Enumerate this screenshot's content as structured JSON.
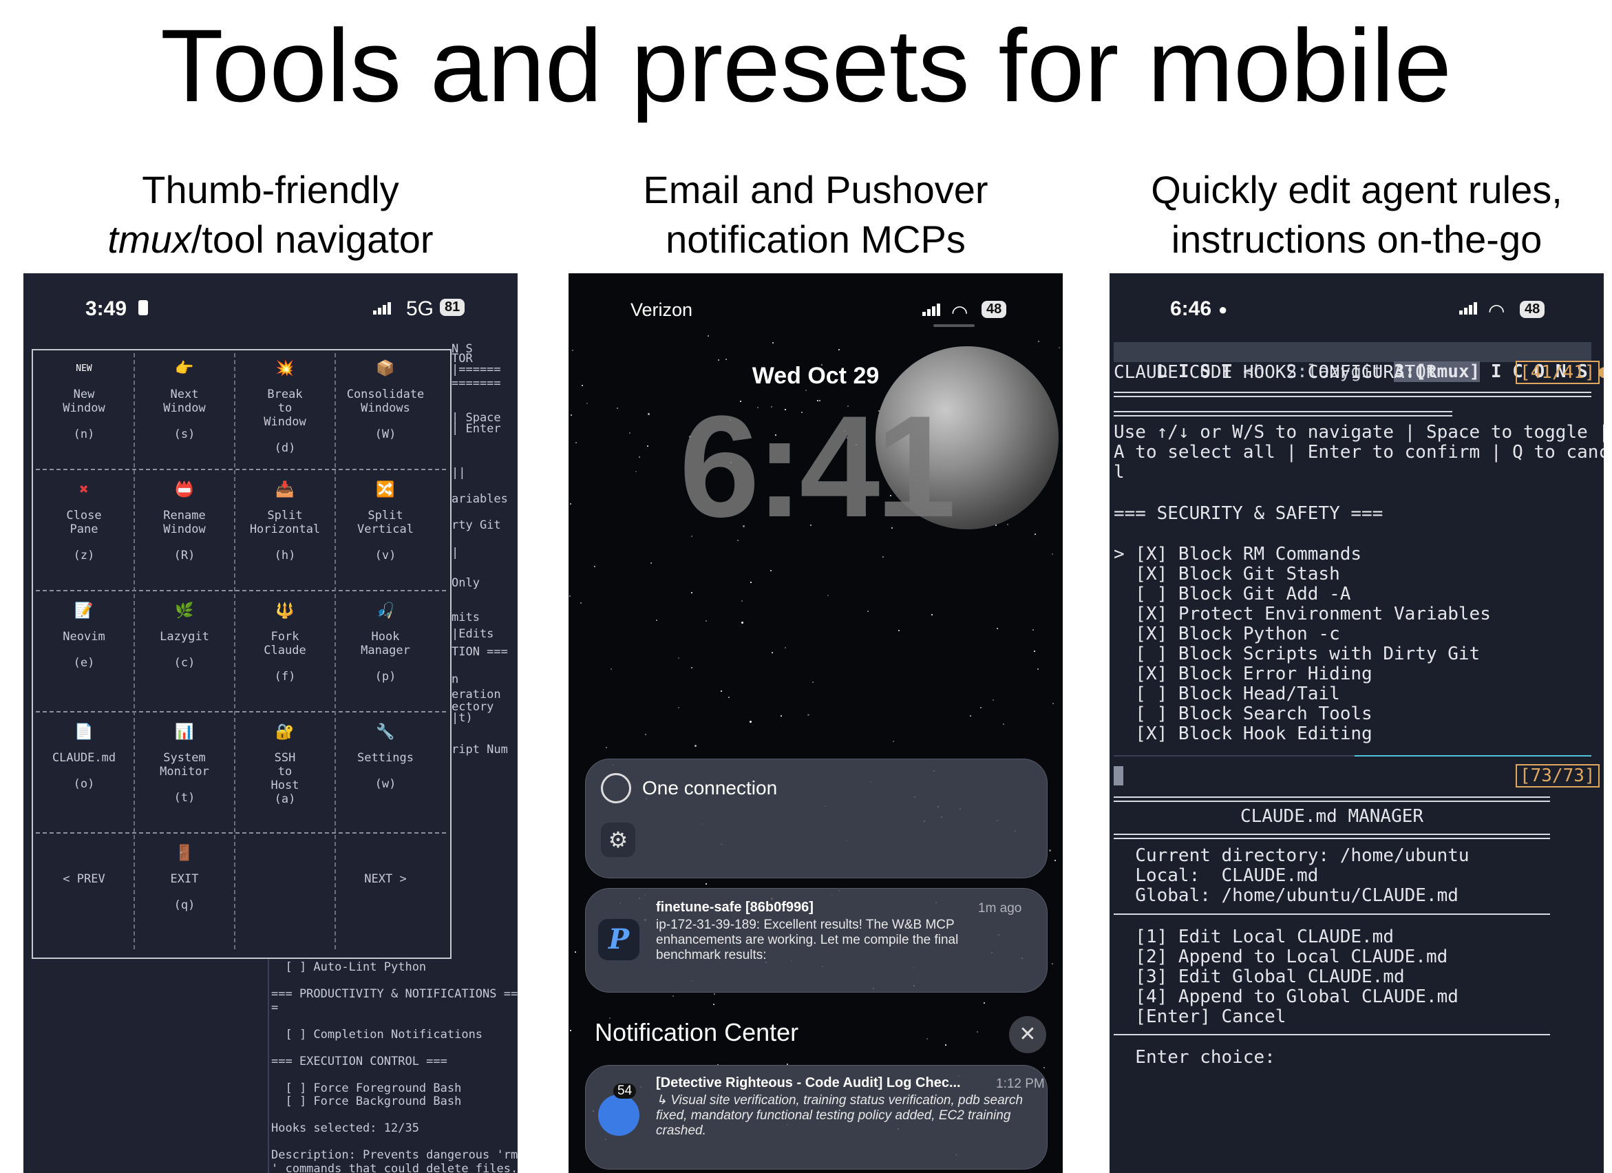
{
  "title": "Tools and presets for mobile",
  "captions": {
    "left_italic": "tmux",
    "left_line1": "Thumb-friendly",
    "left_line2_rest": "/tool navigator",
    "middle_line1": "Email and Pushover",
    "middle_line2": "notification MCPs",
    "right_line1": "Quickly edit agent rules,",
    "right_line2": "instructions on-the-go"
  },
  "phone1": {
    "time": "3:49",
    "network": "5G",
    "battery": "81",
    "cells": [
      {
        "icon": "NEW",
        "label": "New\nWindow",
        "key": "(n)"
      },
      {
        "icon": "👉",
        "label": "Next\nWindow",
        "key": "(s)"
      },
      {
        "icon": "💥",
        "label": "Break\nto\nWindow",
        "key": "(d)"
      },
      {
        "icon": "📦",
        "label": "Consolidate\nWindows",
        "key": "(W)"
      },
      {
        "icon": "✖",
        "label": "Close\nPane",
        "key": "(z)"
      },
      {
        "icon": "📛",
        "label": "Rename\nWindow",
        "key": "(R)"
      },
      {
        "icon": "📥",
        "label": "Split\nHorizontal",
        "key": "(h)"
      },
      {
        "icon": "🔀",
        "label": "Split\nVertical",
        "key": "(v)"
      },
      {
        "icon": "📝",
        "label": "Neovim",
        "key": "(e)"
      },
      {
        "icon": "🌿",
        "label": "Lazygit",
        "key": "(c)"
      },
      {
        "icon": "🔱",
        "label": "Fork\nClaude",
        "key": "(f)"
      },
      {
        "icon": "🎣",
        "label": "Hook\nManager",
        "key": "(p)"
      },
      {
        "icon": "📄",
        "label": "CLAUDE.md",
        "key": "(o)"
      },
      {
        "icon": "📊",
        "label": "System\nMonitor",
        "key": "(t)"
      },
      {
        "icon": "🔐",
        "label": "SSH\nto\nHost\n(a)",
        "key": ""
      },
      {
        "icon": "🔧",
        "label": "Settings",
        "key": "(w)"
      },
      {
        "icon": "",
        "label": "< PREV",
        "key": ""
      },
      {
        "icon": "🚪",
        "label": "EXIT",
        "key": "(q)"
      },
      {
        "icon": "",
        "label": "",
        "key": ""
      },
      {
        "icon": "",
        "label": "NEXT >",
        "key": ""
      }
    ],
    "side_text": [
      "N S",
      "TOR",
      "|======",
      "=======",
      "| Space",
      "| Enter",
      "||",
      "ariables",
      "rty Git",
      "|",
      "Only",
      "mits",
      "|Edits",
      "TION ===",
      "n",
      "eration",
      "ectory",
      "|t)",
      "ript Num"
    ],
    "bottom_lines": [
      "  [ ] Auto-Lint Python",
      "",
      "=== PRODUCTIVITY & NOTIFICATIONS ==",
      "=",
      "",
      "  [ ] Completion Notifications",
      "",
      "=== EXECUTION CONTROL ===",
      "",
      "  [ ] Force Foreground Bash",
      "  [ ] Force Background Bash",
      "",
      "Hooks selected: 12/35",
      "",
      "Description: Prevents dangerous 'rm",
      "' commands that could delete files."
    ]
  },
  "phone2": {
    "carrier": "Verizon",
    "battery": "48",
    "date": "Wed Oct 29",
    "time": "6:41",
    "connection_label": "One connection",
    "notification": {
      "title": "finetune-safe [86b0f996]",
      "time": "1m ago",
      "body": "ip-172-31-39-189: Excellent results! The W&B MCP enhancements are working. Let me compile the final benchmark results:"
    },
    "notification_center_label": "Notification Center",
    "email": {
      "badge": "54",
      "title": "[Detective Righteous - Code Audit] Log Chec...",
      "time": "1:12 PM",
      "body": "↳ Visual site verification, training status verification, pdb search fixed, mandatory functional testing policy added, EC2 training crashed."
    }
  },
  "phone3": {
    "time": "6:46",
    "battery": "48",
    "tabbar": {
      "list": "L I S T",
      "h": "<h",
      "lazygit": "2:lazygit",
      "tmux": "3:[tmux]",
      "icons": "I C O N S"
    },
    "header": "CLAUDE CODE HOOKS CONFIGURATOR",
    "counter_top": "[41/41]",
    "instructions": "Use ↑/↓ or W/S to navigate | Space to toggle |\nA to select all | Enter to confirm | Q to cance\nl",
    "section": "=== SECURITY & SAFETY ===",
    "items": [
      "> [X] Block RM Commands",
      "  [X] Block Git Stash",
      "  [ ] Block Git Add -A",
      "  [X] Protect Environment Variables",
      "  [X] Block Python -c",
      "  [ ] Block Scripts with Dirty Git",
      "  [X] Block Error Hiding",
      "  [ ] Block Head/Tail",
      "  [ ] Block Search Tools",
      "  [X] Block Hook Editing"
    ],
    "counter_bottom": "[73/73]",
    "manager_title": "CLAUDE.md MANAGER",
    "dir_lines": "  Current directory: /home/ubuntu\n  Local:  CLAUDE.md\n  Global: /home/ubuntu/CLAUDE.md",
    "options": "  [1] Edit Local CLAUDE.md\n  [2] Append to Local CLAUDE.md\n  [3] Edit Global CLAUDE.md\n  [4] Append to Global CLAUDE.md\n  [Enter] Cancel",
    "prompt": "  Enter choice:"
  }
}
